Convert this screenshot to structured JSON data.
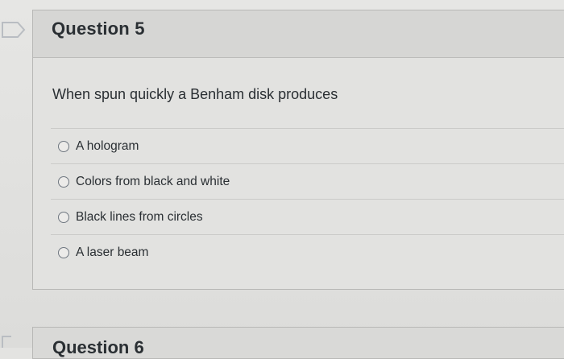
{
  "question": {
    "title": "Question 5",
    "text": "When spun quickly a Benham disk produces",
    "answers": [
      {
        "label": "A hologram"
      },
      {
        "label": "Colors from black and white"
      },
      {
        "label": "Black lines from circles"
      },
      {
        "label": "A laser beam"
      }
    ]
  },
  "next_question": {
    "title": "Question 6"
  },
  "icons": {
    "gutter_flag": "bookmark-flag-icon",
    "radio": "radio-button-icon"
  }
}
